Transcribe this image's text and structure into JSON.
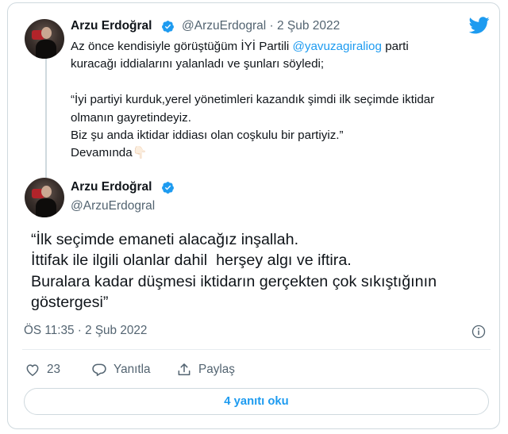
{
  "colors": {
    "accent": "#1d9bf0",
    "muted": "#536471",
    "text": "#0f1419",
    "border": "#cfd9de"
  },
  "quoted_tweet": {
    "author_name": "Arzu Erdoğral",
    "meta": "@ArzuErdogral · 2 Şub 2022",
    "text_prefix": "Az önce kendisiyle görüştüğüm İYİ Partili",
    "mention": "@yavuzagiraliog",
    "text_suffix": "parti",
    "text_line2": "kuracağı iddialarını yalanladı ve şunları söyledi;",
    "text_line3": "“İyi partiyi kurduk,yerel yönetimleri kazandık şimdi ilk seçimde iktidar",
    "text_line4": "olmanın gayretindeyiz.",
    "text_line5": "Biz şu anda iktidar iddiası olan coşkulu bir partiyiz.”",
    "text_line6": "Devamında",
    "emoji": "👇🏻"
  },
  "main_tweet": {
    "author_name": "Arzu Erdoğral",
    "handle": "@ArzuErdogral",
    "lines": [
      "“İlk seçimde emaneti alacağız inşallah.",
      "İttifak ile ilgili olanlar dahil  herşey algı ve iftira.",
      "Buralara kadar düşmesi iktidarın gerçekten çok sıkıştığının",
      "göstergesi”"
    ],
    "timestamp": "ÖS 11:35 · 2 Şub 2022"
  },
  "actions": {
    "like_count": "23",
    "reply_label": "Yanıtla",
    "share_label": "Paylaş"
  },
  "replies_button_label": "4 yanıtı oku",
  "icons": [
    "twitter-bird-icon",
    "verified-badge-icon",
    "info-icon",
    "heart-icon",
    "reply-bubble-icon",
    "share-icon"
  ]
}
